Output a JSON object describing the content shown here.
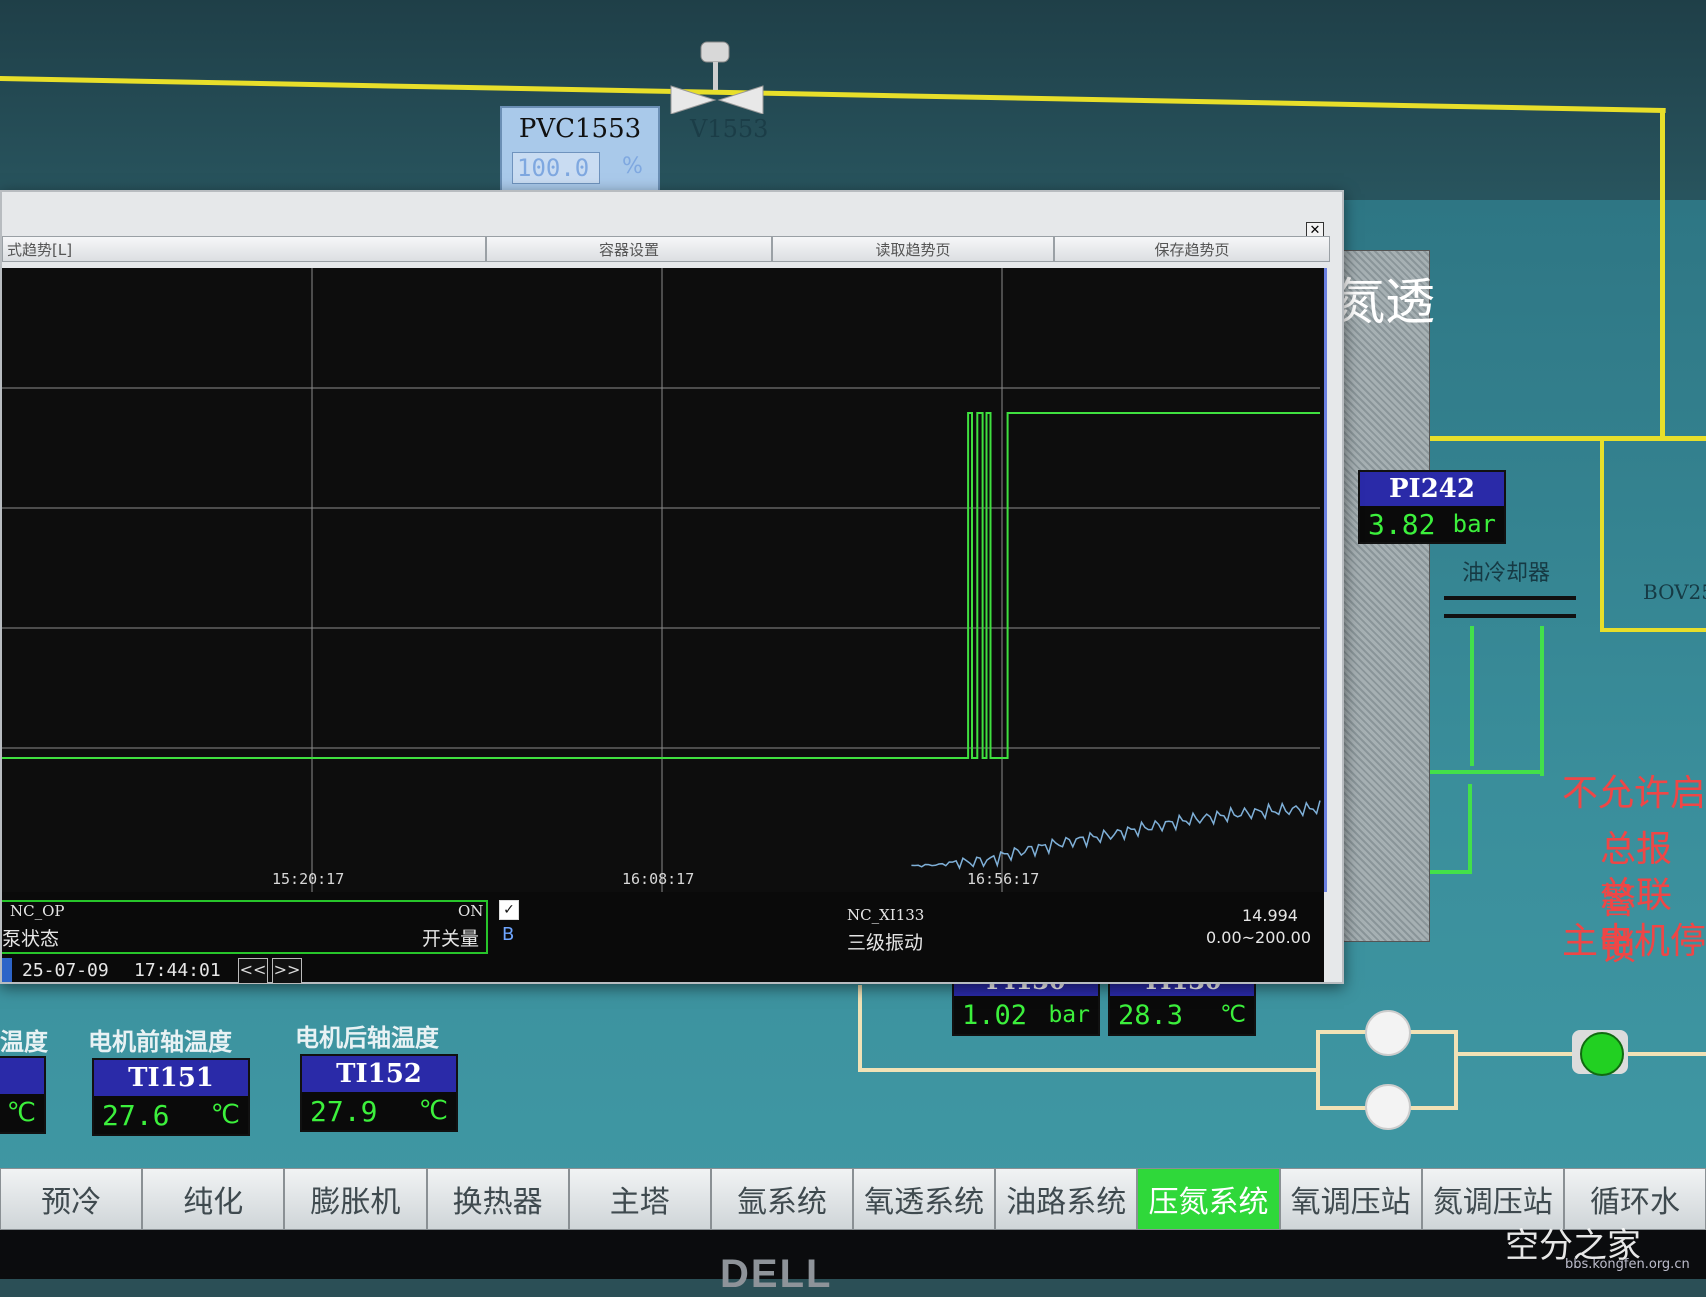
{
  "schematic": {
    "pvc": {
      "name": "PVC1553",
      "value": "100.0",
      "unit": "%"
    },
    "valve_label": "V1553",
    "panel_label": "氮透",
    "oil_cooler_label": "油冷却器",
    "bov_label": "BOV25",
    "alarm_lines": [
      "不允许启",
      "总报警",
      "总联锁",
      "主电机停"
    ],
    "tags": [
      {
        "name": "PI242",
        "value": "3.82",
        "unit": "bar"
      },
      {
        "name": "PI130",
        "value": "1.02",
        "unit": "bar"
      },
      {
        "name": "TI130",
        "value": "28.3",
        "unit": "℃"
      },
      {
        "name": "TI151",
        "value": "27.6",
        "unit": "℃",
        "caption": "电机前轴温度"
      },
      {
        "name": "TI152",
        "value": "27.9",
        "unit": "℃",
        "caption": "电机后轴温度"
      }
    ],
    "partial_caption": "温度",
    "partial_unit": "℃"
  },
  "trend_window": {
    "close_label": "✕",
    "toolbar": [
      "式趋势[L]",
      "容器设置",
      "读取趋势页",
      "保存趋势页"
    ],
    "legend": {
      "left_tag": "NC_OP",
      "left_desc": "泵状态",
      "left_state": "ON",
      "left_type": "开关量",
      "checkbox_mark": "✓",
      "checkbox_label": "B",
      "right_tag": "NC_XI133",
      "right_desc": "三级振动",
      "right_value": "14.994",
      "right_range": "0.00~200.00"
    },
    "timestamp_date": "25-07-09",
    "timestamp_time": "17:44:01",
    "nav_prev": "<<",
    "nav_next": ">>"
  },
  "chart_data": {
    "type": "line",
    "x_ticks": [
      "15:20:17",
      "16:08:17",
      "16:56:17"
    ],
    "series": [
      {
        "tag": "NC_OP",
        "color": "#3fe03f",
        "kind": "binary",
        "x_frac": [
          0.0,
          0.733,
          0.733,
          0.736,
          0.736,
          0.74,
          0.74,
          0.744,
          0.744,
          0.747,
          0.747,
          0.75,
          0.75,
          0.763,
          0.763,
          0.766,
          0.766,
          1.0
        ],
        "state": [
          0,
          0,
          1,
          1,
          0,
          0,
          1,
          1,
          0,
          0,
          1,
          1,
          0,
          0,
          1,
          1,
          1,
          1
        ]
      },
      {
        "tag": "NC_XI133",
        "color": "#7fb0d8",
        "kind": "analog",
        "range": [
          0,
          200
        ],
        "last_value": 14.994,
        "x_frac": [
          0.69,
          0.72,
          0.75,
          0.76,
          0.78,
          0.8,
          0.82,
          0.84,
          0.86,
          0.88,
          0.9,
          0.92,
          0.94,
          0.96,
          0.98,
          1.0
        ],
        "values": [
          0.5,
          1.0,
          2.0,
          3.2,
          4.6,
          6.0,
          7.2,
          8.2,
          9.6,
          10.8,
          12.0,
          12.8,
          13.6,
          14.2,
          14.6,
          14.994
        ]
      }
    ],
    "grid": true
  },
  "nav_tabs": [
    {
      "label": "预冷",
      "active": false
    },
    {
      "label": "纯化",
      "active": false
    },
    {
      "label": "膨胀机",
      "active": false
    },
    {
      "label": "换热器",
      "active": false
    },
    {
      "label": "主塔",
      "active": false
    },
    {
      "label": "氩系统",
      "active": false
    },
    {
      "label": "氧透系统",
      "active": false
    },
    {
      "label": "油路系统",
      "active": false
    },
    {
      "label": "压氮系统",
      "active": true
    },
    {
      "label": "氧调压站",
      "active": false
    },
    {
      "label": "氮调压站",
      "active": false
    },
    {
      "label": "循环水",
      "active": false
    }
  ],
  "watermark": {
    "main": "空分之家",
    "sub": "bbs.kongfen.org.cn"
  },
  "monitor_brand": "DELL"
}
